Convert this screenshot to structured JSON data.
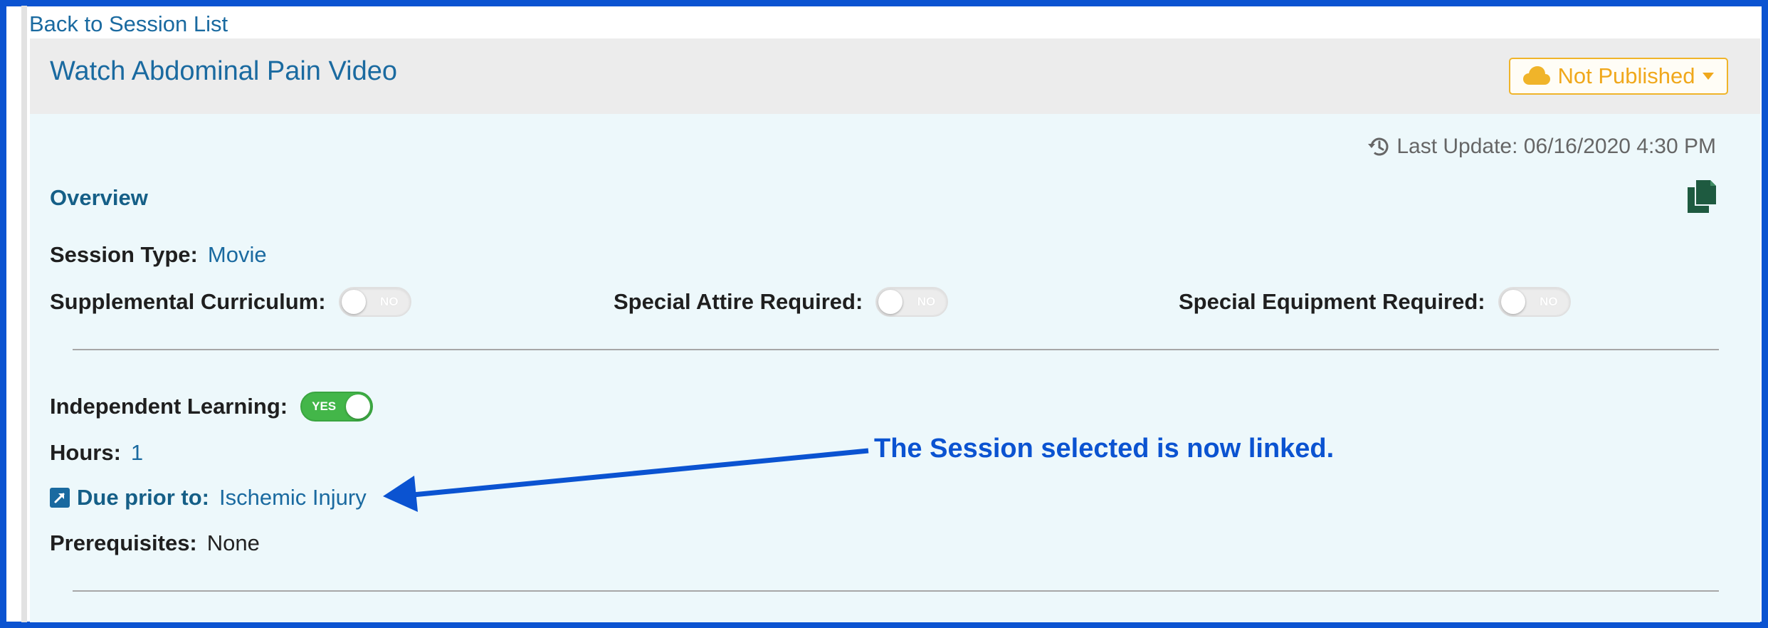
{
  "nav": {
    "back_link": "Back to Session List"
  },
  "header": {
    "title": "Watch Abdominal Pain Video",
    "publish_status": "Not Published"
  },
  "panel": {
    "last_update": "Last Update: 06/16/2020 4:30 PM",
    "overview_title": "Overview",
    "session_type": {
      "label": "Session Type:",
      "value": "Movie"
    },
    "supplemental_curriculum": {
      "label": "Supplemental Curriculum:",
      "state": "NO"
    },
    "special_attire": {
      "label": "Special Attire Required:",
      "state": "NO"
    },
    "special_equipment": {
      "label": "Special Equipment Required:",
      "state": "NO"
    },
    "independent_learning": {
      "label": "Independent Learning:",
      "state": "YES"
    },
    "hours": {
      "label": "Hours:",
      "value": "1"
    },
    "due_prior_to": {
      "label": "Due prior to:",
      "value": "Ischemic Injury"
    },
    "prerequisites": {
      "label": "Prerequisites:",
      "value": "None"
    }
  },
  "annotation": {
    "text": "The Session selected is now linked."
  },
  "colors": {
    "frame_border": "#0b53d1",
    "link": "#1a6aa0",
    "publish": "#f0a81c",
    "toggle_on": "#43b649",
    "panel_bg": "#edf8fb",
    "header_bg": "#ececec"
  }
}
